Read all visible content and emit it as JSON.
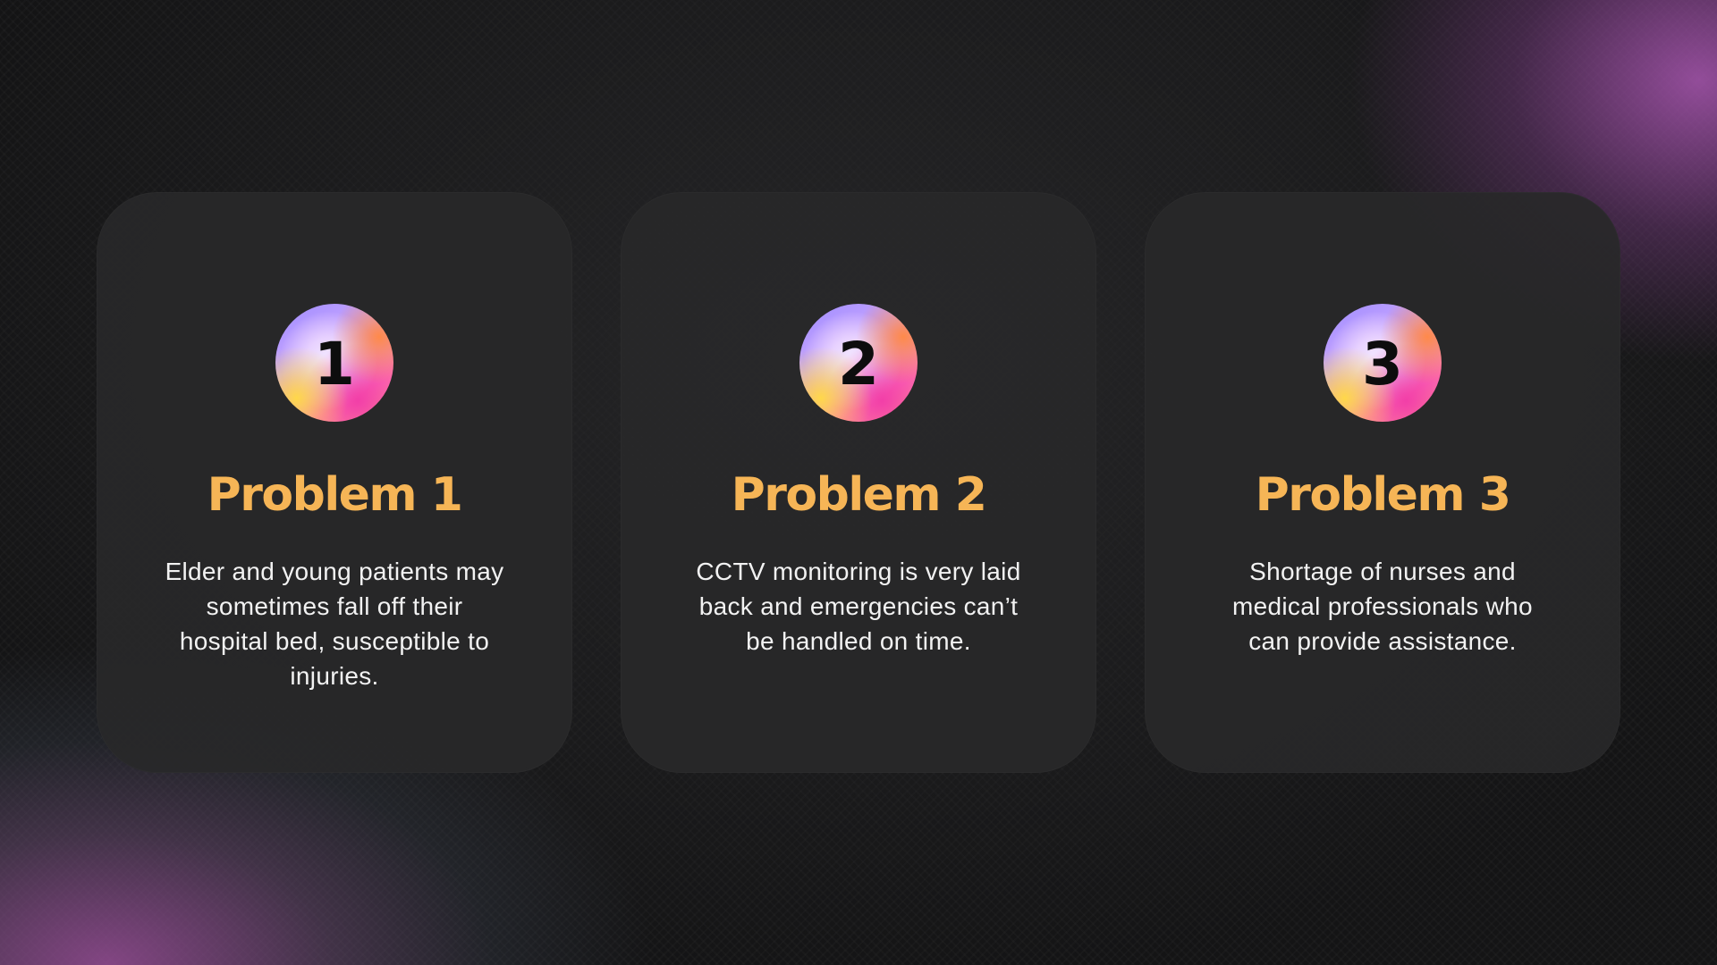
{
  "problems": [
    {
      "number": "1",
      "title": "Problem 1",
      "description": "Elder and young patients may sometimes fall off their hospital bed, susceptible to injuries."
    },
    {
      "number": "2",
      "title": "Problem 2",
      "description": "CCTV monitoring is very laid back and emergencies can’t be handled on time."
    },
    {
      "number": "3",
      "title": "Problem 3",
      "description": "Shortage of nurses and medical professionals who can provide assistance."
    }
  ],
  "colors": {
    "title": "#f6b556",
    "card": "#282829",
    "text": "#f2f2f2",
    "background": "#141415"
  }
}
